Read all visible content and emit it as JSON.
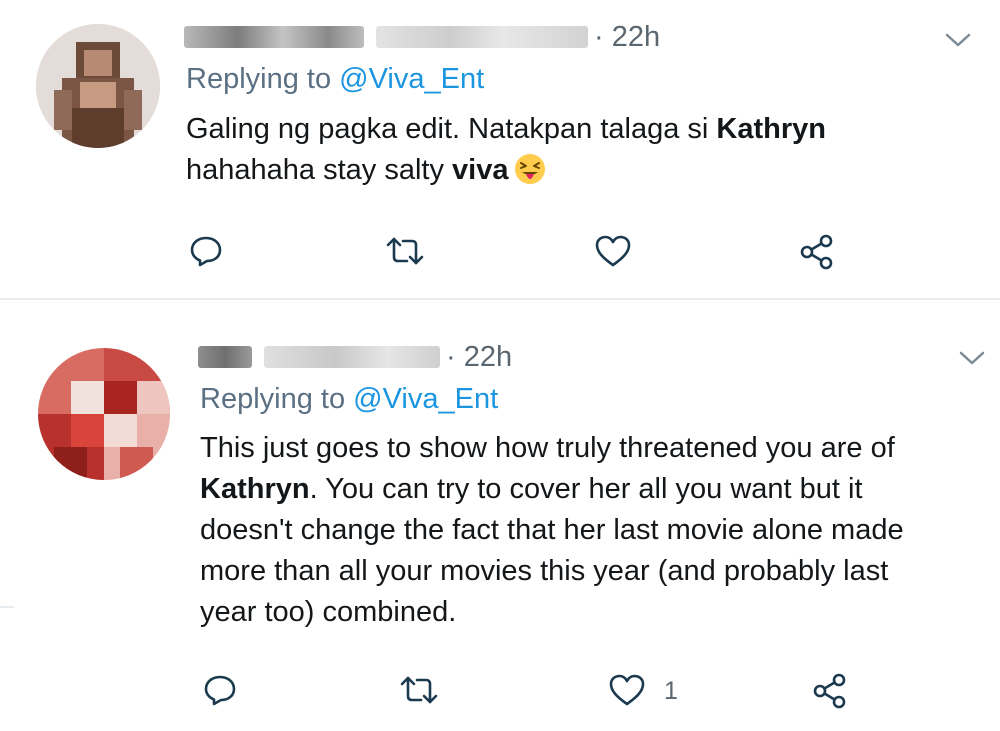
{
  "tweets": [
    {
      "time": "· 22h",
      "reply_prefix": "Replying to ",
      "reply_handle": "@Viva_Ent",
      "body": [
        {
          "text": "Galing ng pagka edit. Natakpan talaga si ",
          "bold": false
        },
        {
          "text": "Kathryn",
          "bold": true
        },
        {
          "text": "hahahaha stay salty ",
          "bold": false
        },
        {
          "text": "viva",
          "bold": true
        }
      ],
      "emoji": "winking-face-with-tongue-emoji",
      "like_count": ""
    },
    {
      "time": "· 22h",
      "reply_prefix": "Replying to ",
      "reply_handle": "@Viva_Ent",
      "body": [
        {
          "text": "This just goes to show how truly threatened you are of",
          "bold": false
        },
        {
          "text": "Kathryn",
          "bold": true
        },
        {
          "text": ". You can try to cover her all you want but it",
          "bold": false
        },
        {
          "text": "doesn't change the fact that her last movie alone made",
          "bold": false
        },
        {
          "text": "more than all your movies this year (and probably last",
          "bold": false
        },
        {
          "text": "year too) combined.",
          "bold": false
        }
      ],
      "like_count": "1"
    }
  ],
  "icons": {
    "reply": "reply-icon",
    "retweet": "retweet-icon",
    "like": "heart-icon",
    "share": "share-icon",
    "menu": "chevron-down-icon"
  },
  "colors": {
    "text": "#14171a",
    "secondary": "#5b7083",
    "link": "#1b95e0",
    "icon": "#1b3a4f",
    "divider": "#e6ecf0"
  }
}
